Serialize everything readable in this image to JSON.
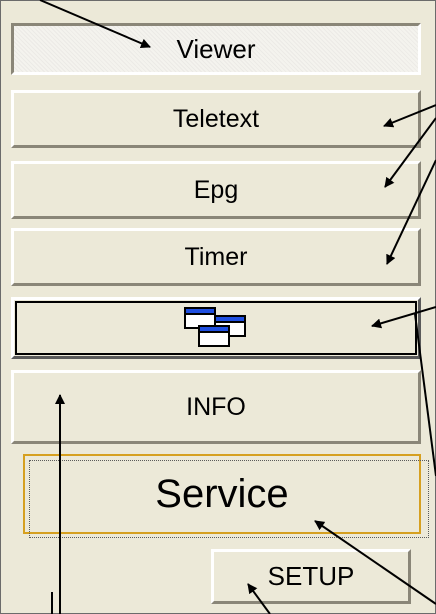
{
  "buttons": {
    "viewer": "Viewer",
    "teletext": "Teletext",
    "epg": "Epg",
    "timer": "Timer",
    "windows_icon": "windows-cascade-icon",
    "info": "INFO",
    "service": "Service",
    "setup": "SETUP"
  },
  "colors": {
    "panel_bg": "#ece9d8",
    "focus_border": "#d6a020",
    "icon_blue": "#1f4fe0"
  }
}
